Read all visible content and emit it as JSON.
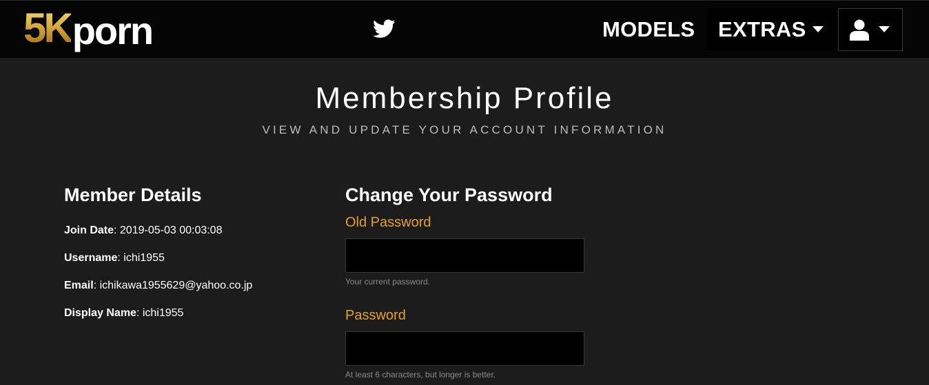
{
  "header": {
    "logo_5k": "5K",
    "logo_porn": "porn",
    "twitter_icon": "twitter-icon",
    "nav_models": "MODELS",
    "nav_extras": "EXTRAS",
    "user_icon": "user-icon"
  },
  "page": {
    "title": "Membership Profile",
    "subtitle": "VIEW AND UPDATE YOUR ACCOUNT INFORMATION"
  },
  "member_details": {
    "title": "Member Details",
    "join_date_label": "Join Date",
    "join_date_value": ": 2019-05-03 00:03:08",
    "username_label": "Username",
    "username_value": ": ichi1955",
    "email_label": "Email",
    "email_value": ": ichikawa1955629@yahoo.co.jp",
    "display_name_label": "Display Name",
    "display_name_value": ": ichi1955"
  },
  "change_password": {
    "title": "Change Your Password",
    "old_password_label": "Old Password",
    "old_password_value": "",
    "old_password_help": "Your current password.",
    "password_label": "Password",
    "password_value": "",
    "password_help": "At least 6 characters, but longer is better."
  },
  "colors": {
    "accent": "#e6a12a",
    "background": "#1c1c1c",
    "header_background": "#050505",
    "input_background": "#000000"
  }
}
